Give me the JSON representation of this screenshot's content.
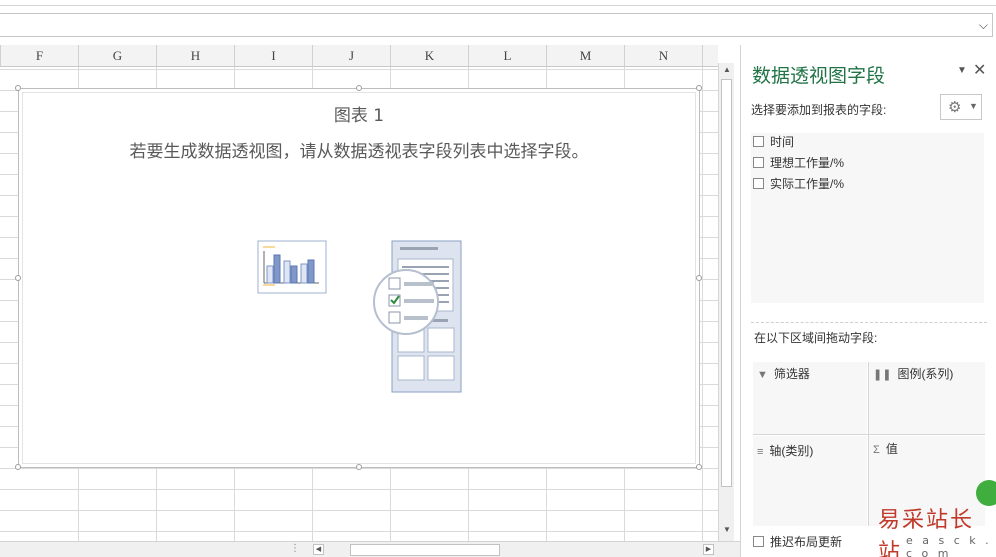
{
  "formula_bar": {
    "dropdown_icon": "chevron-down-icon"
  },
  "columns": [
    "F",
    "G",
    "H",
    "I",
    "J",
    "K",
    "L",
    "M",
    "N"
  ],
  "chart": {
    "title": "图表 1",
    "message": "若要生成数据透视图，请从数据透视表字段列表中选择字段。"
  },
  "pane": {
    "title": "数据透视图字段",
    "subtitle": "选择要添加到报表的字段:",
    "fields": [
      {
        "label": "时间",
        "checked": false
      },
      {
        "label": "理想工作量/%",
        "checked": false
      },
      {
        "label": "实际工作量/%",
        "checked": false
      }
    ],
    "drag_label": "在以下区域间拖动字段:",
    "areas": {
      "filters": "筛选器",
      "legend": "图例(系列)",
      "axis": "轴(类别)",
      "values": "值"
    },
    "defer_update": "推迟布局更新"
  },
  "watermark": {
    "text": "易采站长站",
    "url": "e a s c k . c o m"
  },
  "colors": {
    "accent": "#217346",
    "chart_bar": "#7f97c9",
    "watermark": "#c0392b"
  }
}
